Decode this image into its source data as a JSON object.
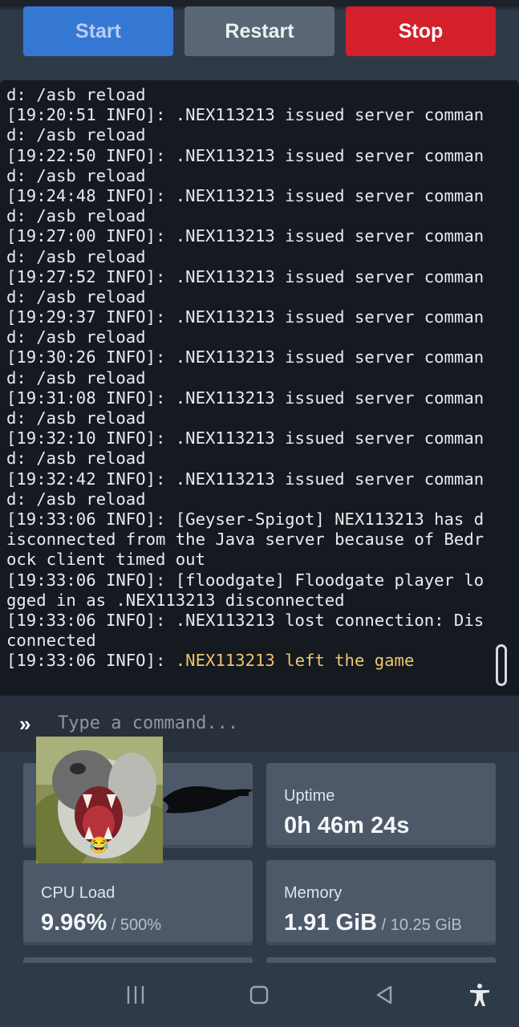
{
  "controls": {
    "start_label": "Start",
    "restart_label": "Restart",
    "stop_label": "Stop"
  },
  "console": {
    "lines": [
      {
        "text": "d: /asb reload"
      },
      {
        "text": "[19:20:51 INFO]: .NEX113213 issued server comman"
      },
      {
        "text": "d: /asb reload"
      },
      {
        "text": "[19:22:50 INFO]: .NEX113213 issued server comman"
      },
      {
        "text": "d: /asb reload"
      },
      {
        "text": "[19:24:48 INFO]: .NEX113213 issued server comman"
      },
      {
        "text": "d: /asb reload"
      },
      {
        "text": "[19:27:00 INFO]: .NEX113213 issued server comman"
      },
      {
        "text": "d: /asb reload"
      },
      {
        "text": "[19:27:52 INFO]: .NEX113213 issued server comman"
      },
      {
        "text": "d: /asb reload"
      },
      {
        "text": "[19:29:37 INFO]: .NEX113213 issued server comman"
      },
      {
        "text": "d: /asb reload"
      },
      {
        "text": "[19:30:26 INFO]: .NEX113213 issued server comman"
      },
      {
        "text": "d: /asb reload"
      },
      {
        "text": "[19:31:08 INFO]: .NEX113213 issued server comman"
      },
      {
        "text": "d: /asb reload"
      },
      {
        "text": "[19:32:10 INFO]: .NEX113213 issued server comman"
      },
      {
        "text": "d: /asb reload"
      },
      {
        "text": "[19:32:42 INFO]: .NEX113213 issued server comman"
      },
      {
        "text": "d: /asb reload"
      },
      {
        "text": "[19:33:06 INFO]: [Geyser-Spigot] NEX113213 has d"
      },
      {
        "text": "isconnected from the Java server because of Bedr"
      },
      {
        "text": "ock client timed out"
      },
      {
        "text": "[19:33:06 INFO]: [floodgate] Floodgate player lo"
      },
      {
        "text": "gged in as .NEX113213 disconnected"
      },
      {
        "text": "[19:33:06 INFO]: .NEX113213 lost connection: Dis"
      },
      {
        "text": "connected"
      },
      {
        "text": "[19:33:06 INFO]: ",
        "highlight": ".NEX113213 left the game"
      }
    ],
    "highlight_color": "#f2c36b"
  },
  "command": {
    "prompt": "»",
    "placeholder": "Type a command..."
  },
  "stats": {
    "uptime": {
      "label": "Uptime",
      "value": "0h 46m 24s"
    },
    "cpu": {
      "label": "CPU Load",
      "value": "9.96%",
      "limit": " / 500%"
    },
    "memory": {
      "label": "Memory",
      "value": "1.91 GiB",
      "limit": " / 10.25 GiB"
    }
  },
  "sticker": {
    "emoji": "😂"
  },
  "colors": {
    "start": "#3578d4",
    "restart": "#5a6674",
    "stop": "#d3202a",
    "console_bg": "#141a20",
    "card_bg": "#4d5968"
  },
  "navbar": {
    "icons": [
      "recents-icon",
      "home-icon",
      "back-icon",
      "accessibility-icon"
    ]
  }
}
